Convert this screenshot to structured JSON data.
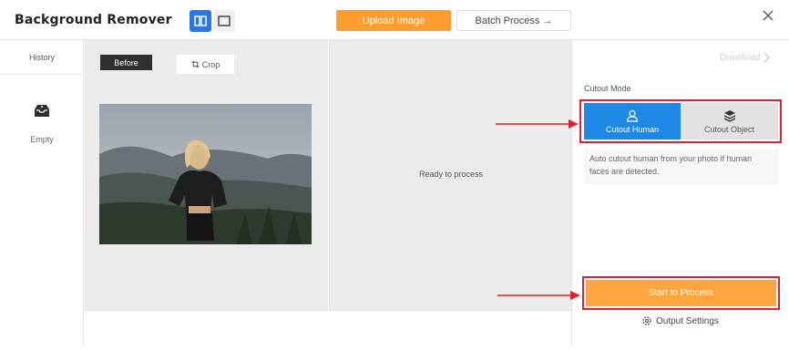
{
  "app": {
    "title": "Background Remover"
  },
  "toolbar": {
    "upload_label": "Upload Image",
    "batch_label": "Batch Process →",
    "close_icon": "close-icon",
    "layout_icons": [
      "split-view-icon",
      "single-view-icon"
    ]
  },
  "sidebar": {
    "history_label": "History",
    "empty_label": "Empty",
    "empty_icon": "empty-tray-icon"
  },
  "preview": {
    "before_label": "Before",
    "crop_label": "Crop",
    "crop_icon": "crop-icon",
    "ready_text": "Ready to process"
  },
  "right_panel": {
    "download_label": "Download",
    "cutout_mode_label": "Cutout Mode",
    "modes": [
      {
        "label": "Cutout Human",
        "icon": "person-icon",
        "selected": true
      },
      {
        "label": "Cutout Object",
        "icon": "layers-icon",
        "selected": false
      }
    ],
    "mode_description": "Auto cutout human from your photo if human faces are detected.",
    "process_label": "Start to Process",
    "output_settings_label": "Output Settings",
    "output_settings_icon": "gear-icon"
  },
  "colors": {
    "accent_blue": "#1e88e5",
    "accent_orange": "#ff9d2e",
    "annotation_red": "#e0202a"
  }
}
